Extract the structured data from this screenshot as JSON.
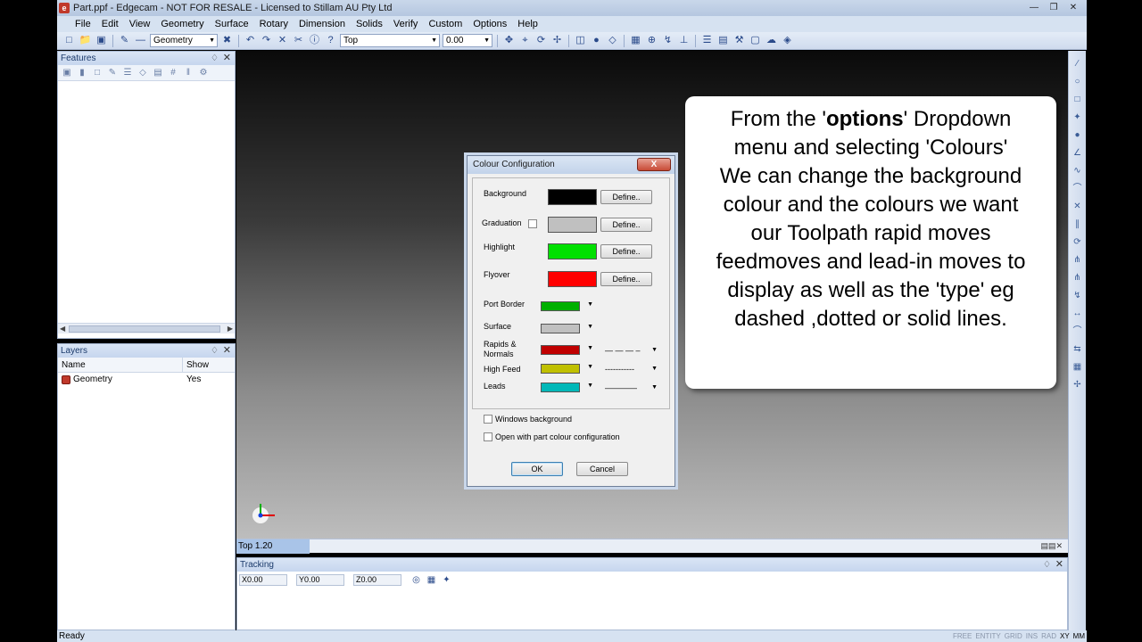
{
  "window": {
    "title": "Part.ppf - Edgecam - NOT FOR RESALE - Licensed to Stillam AU Pty Ltd"
  },
  "menu": [
    "File",
    "Edit",
    "View",
    "Geometry",
    "Surface",
    "Rotary",
    "Dimension",
    "Solids",
    "Verify",
    "Custom",
    "Options",
    "Help"
  ],
  "toolbar": {
    "layer_combo": "Geometry",
    "view_combo": "Top",
    "value_combo": "0.00"
  },
  "features_panel": {
    "title": "Features"
  },
  "layers_panel": {
    "title": "Layers",
    "columns": [
      "Name",
      "Show"
    ],
    "rows": [
      {
        "name": "Geometry",
        "show": "Yes"
      }
    ]
  },
  "viewport": {
    "status_tab": "Top 1.20"
  },
  "tracking": {
    "title": "Tracking",
    "x": "X0.00",
    "y": "Y0.00",
    "z": "Z0.00"
  },
  "statusbar": {
    "text": "Ready",
    "indicators": [
      "FREE",
      "ENTITY",
      "GRID",
      "INS",
      "RAD",
      "XY",
      "MM"
    ]
  },
  "dialog": {
    "title": "Colour Configuration",
    "close": "X",
    "background_label": "Background",
    "graduation_label": "Graduation",
    "highlight_label": "Highlight",
    "flyover_label": "Flyover",
    "define_label": "Define..",
    "port_border_label": "Port Border",
    "surface_label": "Surface",
    "rapids_label_1": "Rapids &",
    "rapids_label_2": "Normals",
    "high_feed_label": "High Feed",
    "leads_label": "Leads",
    "rapids_line": "— — — –",
    "high_feed_line": "-----------",
    "leads_line": "————",
    "windows_background": "Windows background",
    "open_with_part": "Open with part colour configuration",
    "ok": "OK",
    "cancel": "Cancel",
    "colors": {
      "background": "#000000",
      "graduation": "#c0c0c0",
      "highlight": "#00e000",
      "flyover": "#ff0000",
      "port_border": "#00b000",
      "surface": "#c0c0c0",
      "rapids": "#c00000",
      "high_feed": "#c0c000",
      "leads": "#00b8b8"
    }
  },
  "callout": {
    "line1_pre": "From the '",
    "line1_bold": "options",
    "line1_post": "' Dropdown",
    "line2": "menu and selecting 'Colours'",
    "line3": "We can change the background",
    "line4": "colour and the colours we want",
    "line5": "our Toolpath rapid moves",
    "line6": "feedmoves and lead-in moves to",
    "line7": "display as well as the 'type' eg",
    "line8": "dashed ,dotted or solid lines."
  }
}
